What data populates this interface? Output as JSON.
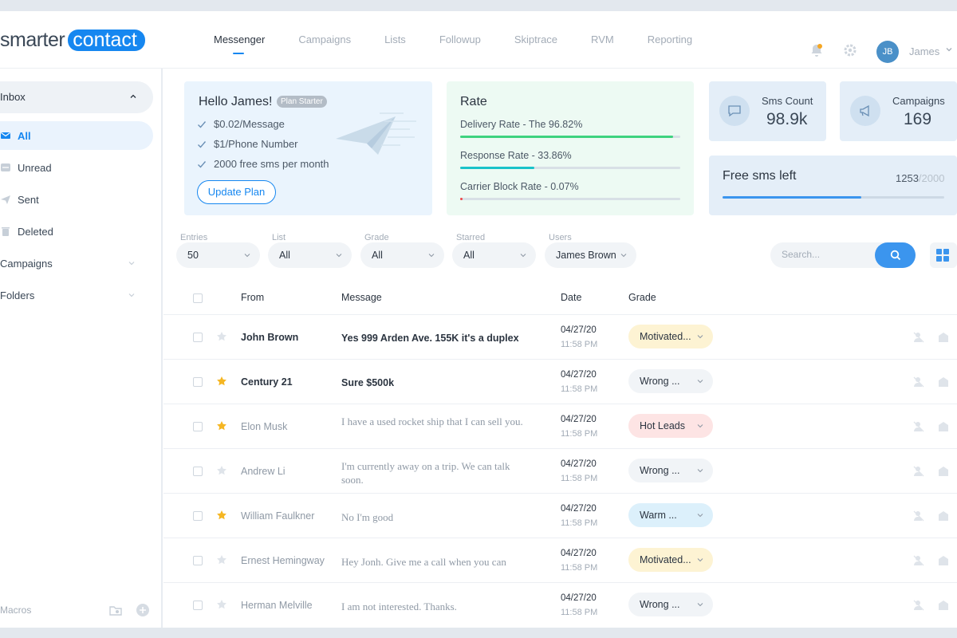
{
  "brand": {
    "part1": "smarter",
    "part2": "contact"
  },
  "nav": [
    {
      "label": "Messenger",
      "active": true
    },
    {
      "label": "Campaigns"
    },
    {
      "label": "Lists"
    },
    {
      "label": "Followup"
    },
    {
      "label": "Skiptrace"
    },
    {
      "label": "RVM"
    },
    {
      "label": "Reporting"
    }
  ],
  "user": {
    "initials": "JB",
    "name": "James"
  },
  "sidebar": {
    "inbox_label": "Inbox",
    "items": [
      {
        "label": "All",
        "icon": "mail-icon",
        "active": true
      },
      {
        "label": "Unread",
        "icon": "unread-icon"
      },
      {
        "label": "Sent",
        "icon": "send-icon"
      },
      {
        "label": "Deleted",
        "icon": "trash-icon"
      },
      {
        "label": "Campaigns",
        "expandable": true
      },
      {
        "label": "Folders",
        "expandable": true
      }
    ],
    "macros_label": "Macros"
  },
  "hello": {
    "title": "Hello James!",
    "plan_badge": "Plan Starter",
    "perks": [
      "$0.02/Message",
      "$1/Phone Number",
      "2000 free sms per month"
    ],
    "button": "Update Plan"
  },
  "rate": {
    "title": "Rate",
    "items": [
      {
        "label": "Delivery Rate - The 96.82%",
        "percent": 96.82,
        "color": "#3ed37f"
      },
      {
        "label": "Response Rate - 33.86%",
        "percent": 33.86,
        "color": "#19c3c9"
      },
      {
        "label": "Carrier Block Rate - 0.07%",
        "percent": 0.07,
        "color": "#f04848"
      }
    ]
  },
  "stats": {
    "sms_label": "Sms Count",
    "sms_value": "98.9k",
    "campaigns_label": "Campaigns",
    "campaigns_value": "169"
  },
  "free_sms": {
    "title": "Free sms left",
    "left": "1253",
    "total": "/2000",
    "fraction": 0.6265
  },
  "filters": [
    {
      "label": "Entries",
      "value": "50"
    },
    {
      "label": "List",
      "value": "All"
    },
    {
      "label": "Grade",
      "value": "All"
    },
    {
      "label": "Starred",
      "value": "All"
    },
    {
      "label": "Users",
      "value": "James Brown"
    }
  ],
  "search": {
    "placeholder": "Search..."
  },
  "table": {
    "headers": {
      "from": "From",
      "message": "Message",
      "date": "Date",
      "grade": "Grade"
    },
    "rows": [
      {
        "from": "John Brown",
        "message": "Yes 999 Arden Ave. 155K it's a duplex",
        "date": "04/27/20",
        "time": "11:58 PM",
        "grade": "Motivated...",
        "grade_color": "#fdf3d3",
        "starred": false,
        "unread": true
      },
      {
        "from": "Century 21",
        "message": "Sure $500k",
        "date": "04/27/20",
        "time": "11:58 PM",
        "grade": "Wrong ...",
        "grade_color": "#f1f4f7",
        "starred": true,
        "unread": true
      },
      {
        "from": "Elon Musk",
        "message": "I have a used rocket ship that I can sell you.",
        "date": "04/27/20",
        "time": "11:58 PM",
        "grade": "Hot Leads",
        "grade_color": "#fde4e4",
        "starred": true,
        "unread": false
      },
      {
        "from": "Andrew Li",
        "message": "I'm currently away on a trip. We can talk soon.",
        "date": "04/27/20",
        "time": "11:58 PM",
        "grade": "Wrong ...",
        "grade_color": "#f1f4f7",
        "starred": false,
        "unread": false
      },
      {
        "from": "William Faulkner",
        "message": "No I'm good",
        "date": "04/27/20",
        "time": "11:58 PM",
        "grade": "Warm ...",
        "grade_color": "#dcf0fb",
        "starred": true,
        "unread": false
      },
      {
        "from": "Ernest Hemingway",
        "message": "Hey Jonh. Give me a call when you can",
        "date": "04/27/20",
        "time": "11:58 PM",
        "grade": "Motivated...",
        "grade_color": "#fdf3d3",
        "starred": false,
        "unread": false
      },
      {
        "from": "Herman Melville",
        "message": "I am not interested. Thanks.",
        "date": "04/27/20",
        "time": "11:58 PM",
        "grade": "Wrong ...",
        "grade_color": "#f1f4f7",
        "starred": false,
        "unread": false
      }
    ]
  },
  "colors": {
    "accent": "#1687f0",
    "star": "#f5b623"
  }
}
